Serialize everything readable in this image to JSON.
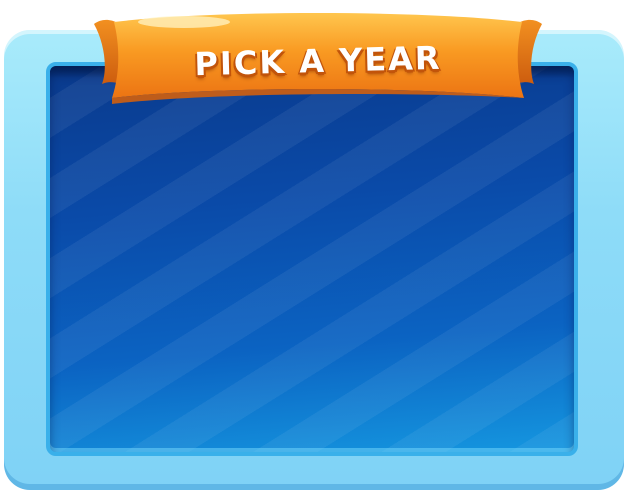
{
  "banner": {
    "title": "PICK A YEAR"
  },
  "colors": {
    "frame": "#8edcf8",
    "panel_top": "#0a3a8c",
    "panel_bottom": "#1597e0",
    "banner_orange": "#f7921e",
    "banner_light": "#ffc24a",
    "banner_dark": "#d8620f"
  }
}
